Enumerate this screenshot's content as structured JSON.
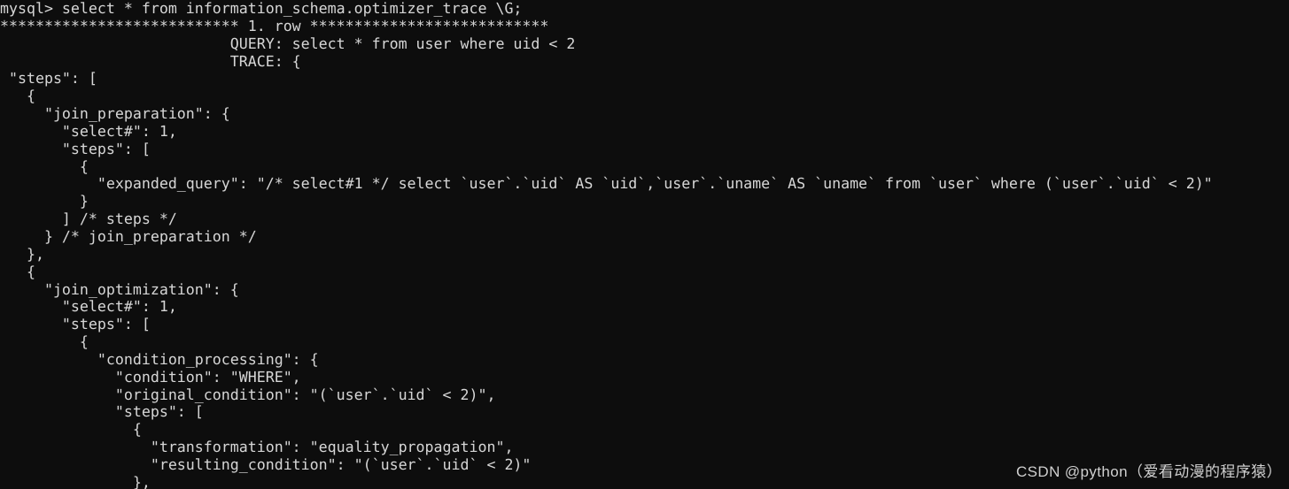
{
  "terminal": {
    "background_color": "#0d0d0d",
    "text_color": "#d6d6d6",
    "prompt": "mysql>",
    "command": "select * from information_schema.optimizer_trace \\G;",
    "row_separator": "*************************** 1. row ***************************",
    "fields": {
      "query_label": "QUERY:",
      "query_value": "select * from user where uid < 2",
      "trace_label": "TRACE:",
      "trace_value": "{"
    },
    "lines": [
      "mysql> select * from information_schema.optimizer_trace \\G;",
      "*************************** 1. row ***************************",
      "                          QUERY: select * from user where uid < 2",
      "                          TRACE: {",
      " \"steps\": [",
      "   {",
      "     \"join_preparation\": {",
      "       \"select#\": 1,",
      "       \"steps\": [",
      "         {",
      "           \"expanded_query\": \"/* select#1 */ select `user`.`uid` AS `uid`,`user`.`uname` AS `uname` from `user` where (`user`.`uid` < 2)\"",
      "         }",
      "       ] /* steps */",
      "     } /* join_preparation */",
      "   },",
      "   {",
      "     \"join_optimization\": {",
      "       \"select#\": 1,",
      "       \"steps\": [",
      "         {",
      "           \"condition_processing\": {",
      "             \"condition\": \"WHERE\",",
      "             \"original_condition\": \"(`user`.`uid` < 2)\",",
      "             \"steps\": [",
      "               {",
      "                 \"transformation\": \"equality_propagation\",",
      "                 \"resulting_condition\": \"(`user`.`uid` < 2)\"",
      "               },"
    ]
  },
  "watermark": {
    "text": "CSDN @python（爱看动漫的程序猿）"
  }
}
